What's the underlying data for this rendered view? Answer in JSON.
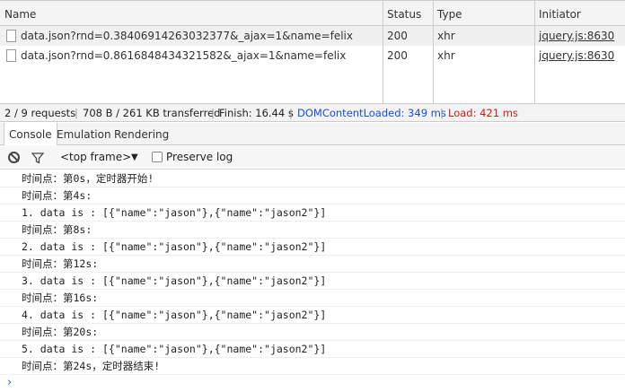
{
  "network": {
    "headers": {
      "name": "Name",
      "status": "Status",
      "type": "Type",
      "initiator": "Initiator"
    },
    "rows": [
      {
        "name": "data.json?rnd=0.38406914263032377&_ajax=1&name=felix",
        "status": "200",
        "type": "xhr",
        "initiator": "jquery.js:8630"
      },
      {
        "name": "data.json?rnd=0.8616848434321582&_ajax=1&name=felix",
        "status": "200",
        "type": "xhr",
        "initiator": "jquery.js:8630"
      }
    ]
  },
  "summary": {
    "requests": "2 / 9 requests",
    "transferred": "708 B / 261 KB transferred",
    "finish": "Finish: 16.44 s",
    "dcl": "DOMContentLoaded: 349 ms",
    "load": "Load: 421 ms",
    "separator": "|"
  },
  "tabs": [
    "Console",
    "Emulation",
    "Rendering"
  ],
  "toolbar": {
    "frame": "<top frame>",
    "dropdown_arrow": "▼",
    "preserve_log": "Preserve log"
  },
  "console": {
    "messages": [
      "时间点：第0s，定时器开始!",
      "时间点：第4s:",
      "1. data is : [{\"name\":\"jason\"},{\"name\":\"jason2\"}]",
      "时间点：第8s:",
      "2. data is : [{\"name\":\"jason\"},{\"name\":\"jason2\"}]",
      "时间点：第12s:",
      "3. data is : [{\"name\":\"jason\"},{\"name\":\"jason2\"}]",
      "时间点：第16s:",
      "4. data is : [{\"name\":\"jason\"},{\"name\":\"jason2\"}]",
      "时间点：第20s:",
      "5. data is : [{\"name\":\"jason\"},{\"name\":\"jason2\"}]",
      "时间点：第24s，定时器结束!"
    ],
    "prompt": "›"
  },
  "colors": {
    "dcl": "#1a4fd6",
    "load": "#d21a1a",
    "prompt": "#2a62d6"
  }
}
